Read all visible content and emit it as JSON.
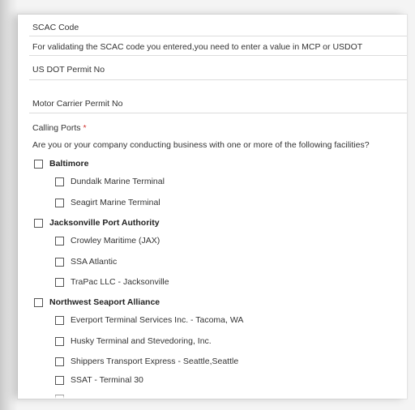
{
  "form": {
    "scac_label": "SCAC Code",
    "scac_hint": "For validating the SCAC code you entered,you need to enter a value in MCP or USDOT",
    "usdot_label": "US DOT Permit No",
    "mcp_label": "Motor Carrier Permit No",
    "calling_ports_label": "Calling Ports",
    "required_marker": "*",
    "question": "Are you or your company conducting business with one or more of the following facilities?"
  },
  "ports": [
    {
      "name": "Baltimore",
      "checked": false,
      "facilities": [
        {
          "name": "Dundalk Marine Terminal",
          "checked": false
        },
        {
          "name": "Seagirt Marine Terminal",
          "checked": false
        }
      ]
    },
    {
      "name": "Jacksonville Port Authority",
      "checked": false,
      "facilities": [
        {
          "name": "Crowley Maritime (JAX)",
          "checked": false
        },
        {
          "name": "SSA Atlantic",
          "checked": false
        },
        {
          "name": "TraPac LLC - Jacksonville",
          "checked": false
        }
      ]
    },
    {
      "name": "Northwest Seaport Alliance",
      "checked": false,
      "facilities": [
        {
          "name": "Everport Terminal Services Inc. - Tacoma, WA",
          "checked": false
        },
        {
          "name": "Husky Terminal and Stevedoring, Inc.",
          "checked": false
        },
        {
          "name": "Shippers Transport Express - Seattle,Seattle",
          "checked": false
        },
        {
          "name": "SSAT - Terminal 30",
          "checked": false
        },
        {
          "name": "",
          "checked": false
        }
      ]
    }
  ]
}
